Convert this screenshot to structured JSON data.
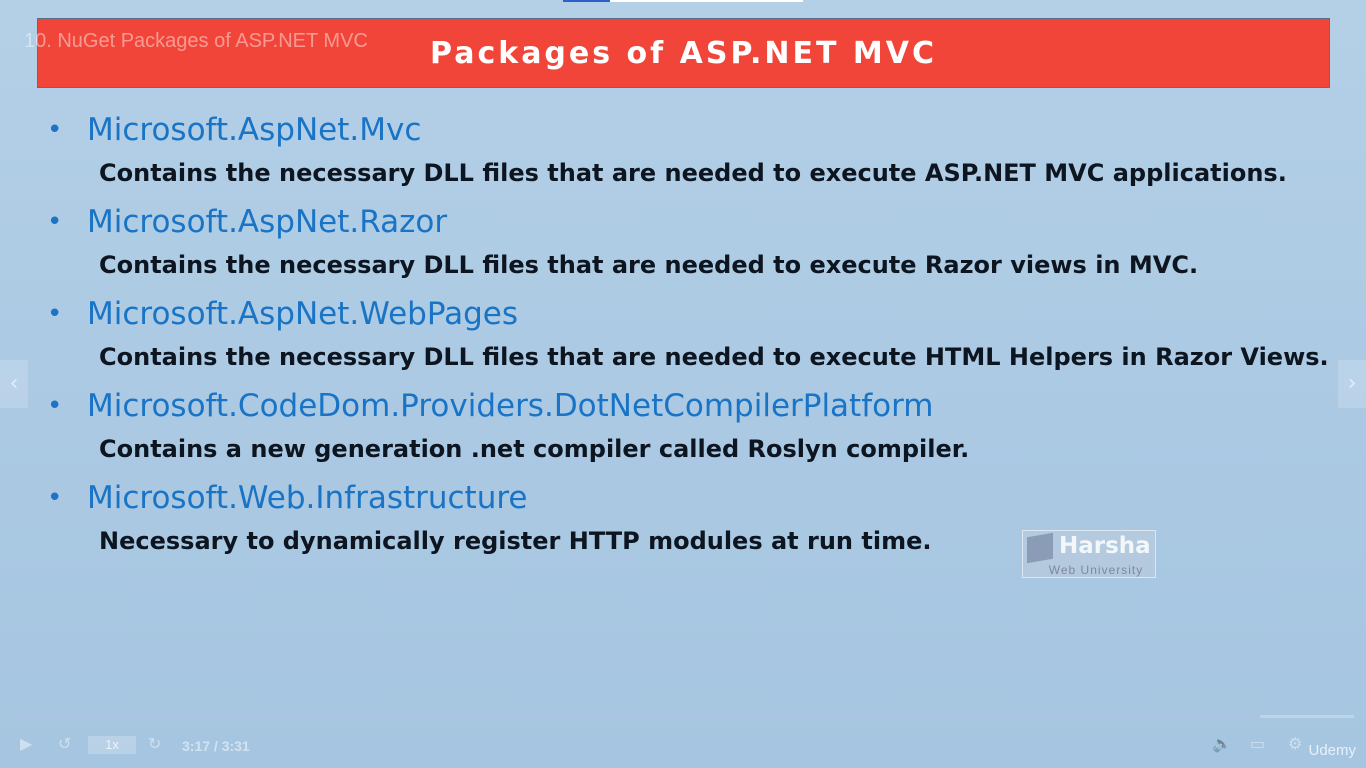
{
  "lecture": {
    "title": "10. NuGet Packages of ASP.NET MVC"
  },
  "slide": {
    "title": "Packages of ASP.NET MVC",
    "packages": [
      {
        "name": "Microsoft.AspNet.Mvc",
        "description": "Contains the necessary DLL files that are needed to execute ASP.NET MVC applications."
      },
      {
        "name": "Microsoft.AspNet.Razor",
        "description": "Contains the necessary DLL files that are needed to execute Razor views in MVC."
      },
      {
        "name": "Microsoft.AspNet.WebPages",
        "description": "Contains the necessary DLL files that are needed to execute HTML Helpers in Razor Views."
      },
      {
        "name": "Microsoft.CodeDom.Providers.DotNetCompilerPlatform",
        "description": "Contains a new generation .net compiler called Roslyn compiler."
      },
      {
        "name": "Microsoft.Web.Infrastructure",
        "description": "Necessary to dynamically register HTTP modules at run time."
      }
    ],
    "watermark": {
      "name": "Harsha",
      "subtitle": "Web University"
    }
  },
  "player": {
    "speed": "1x",
    "time": "3:17 / 3:31",
    "progress": 0.93,
    "brand": "Udemy"
  },
  "colors": {
    "background": "#b4d0e7",
    "banner": "#f2453a",
    "package_name": "#1a74c6",
    "description": "#0d1520"
  },
  "icons": {
    "bullet": "•",
    "prev": "chevron-left-icon",
    "next": "chevron-right-icon",
    "play": "play-icon",
    "rewind": "rewind-icon",
    "forward": "forward-icon",
    "volume": "volume-icon",
    "captions": "captions-icon",
    "settings": "settings-icon"
  }
}
